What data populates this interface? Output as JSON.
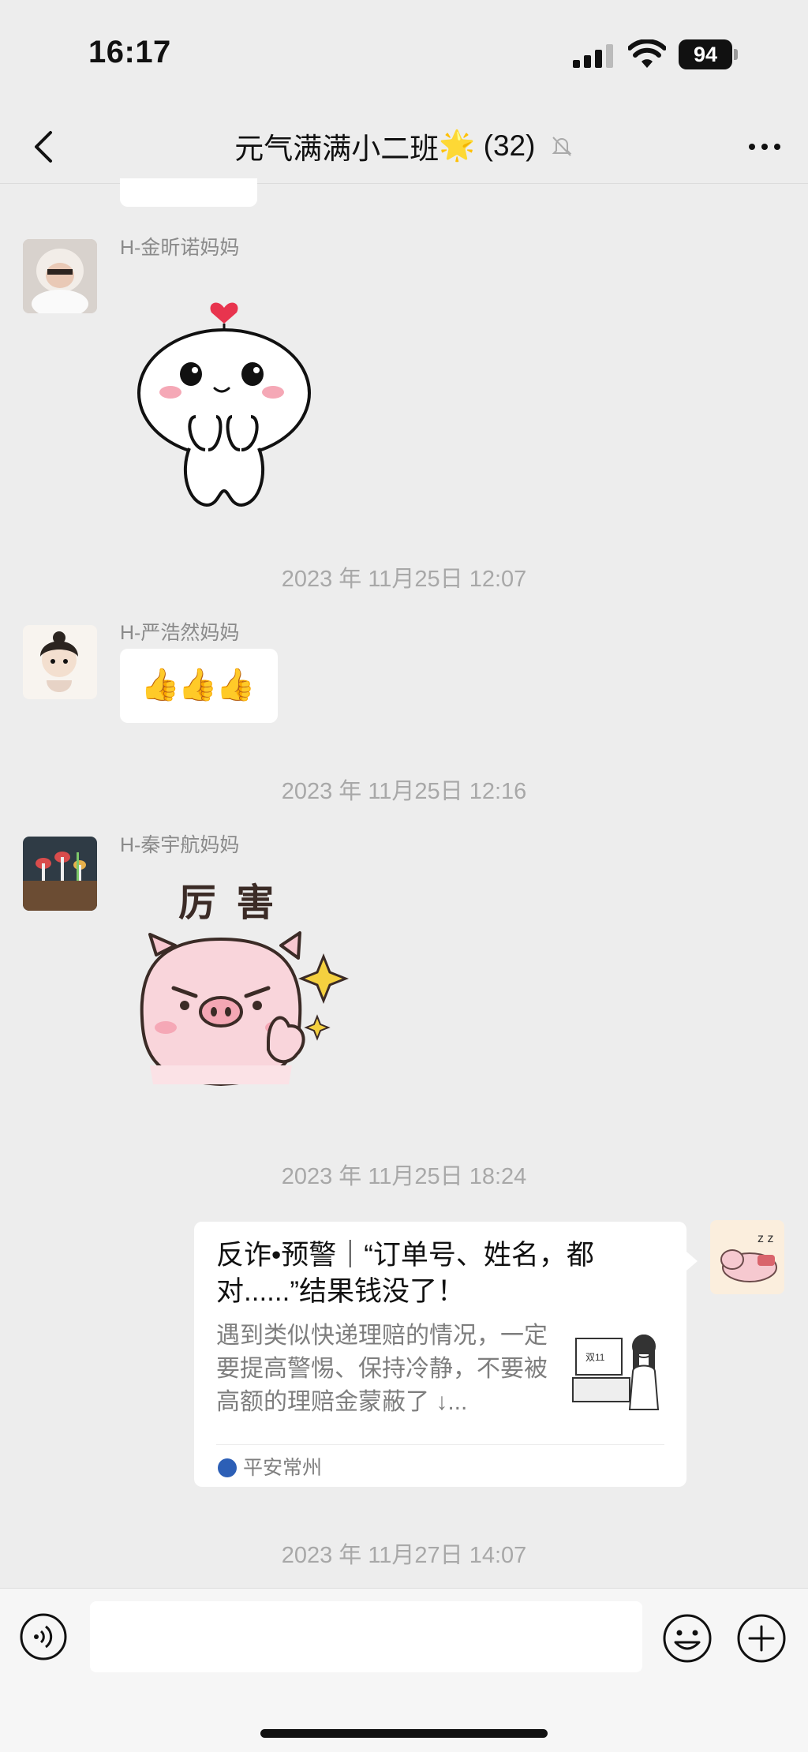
{
  "status": {
    "time": "16:17",
    "battery": "94"
  },
  "nav": {
    "title": "元气满满小二班",
    "title_emoji": "🌟",
    "member_count": "(32)"
  },
  "messages": {
    "m1": {
      "sender": "H-金昕诺妈妈"
    },
    "ts1": "2023 年 11月25日 12:07",
    "m2": {
      "sender": "H-严浩然妈妈",
      "text": "👍👍👍"
    },
    "ts2": "2023 年 11月25日 12:16",
    "m3": {
      "sender": "H-秦宇航妈妈",
      "sticker_text": "厉 害"
    },
    "ts3": "2023 年 11月25日 18:24",
    "card": {
      "title": "反诈•预警｜“订单号、姓名，都对......”结果钱没了！",
      "desc": "遇到类似快递理赔的情况，一定要提高警惕、保持冷静，不要被高额的理赔金蒙蔽了 ↓...",
      "source": "平安常州",
      "thumb_label": "双11"
    },
    "ts4": "2023 年 11月27日 14:07"
  }
}
